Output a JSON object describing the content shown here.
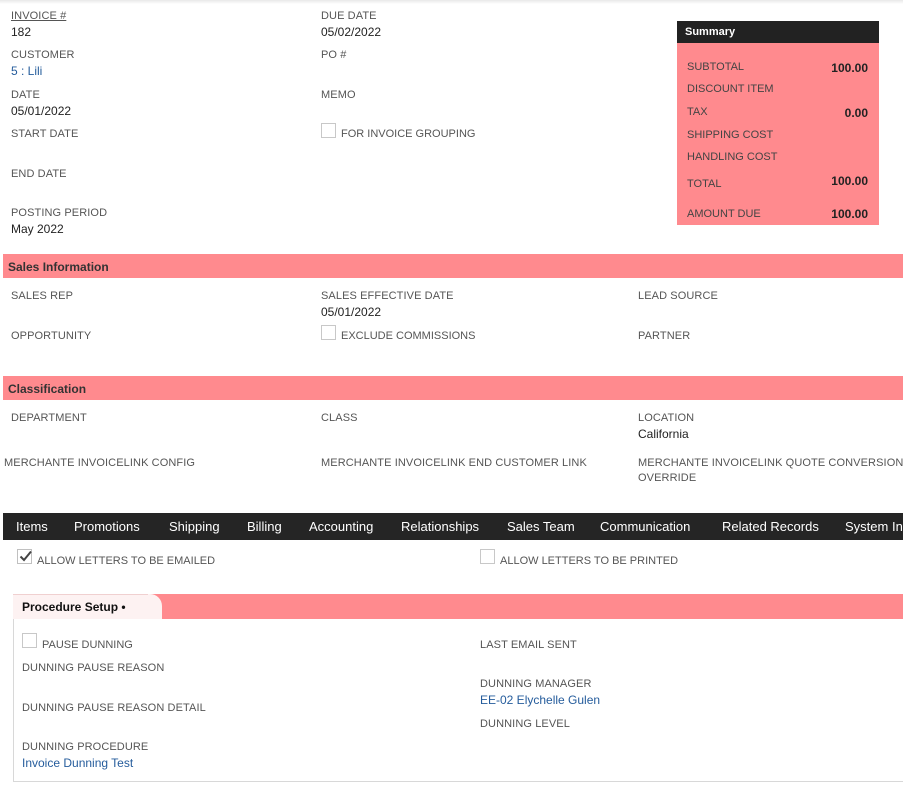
{
  "primary": {
    "invoice_label": "INVOICE #",
    "invoice_value": "182",
    "customer_label": "CUSTOMER",
    "customer_value": "5 : Lili",
    "date_label": "DATE",
    "date_value": "05/01/2022",
    "start_date_label": "START DATE",
    "end_date_label": "END DATE",
    "posting_period_label": "POSTING PERIOD",
    "posting_period_value": "May 2022",
    "due_date_label": "DUE DATE",
    "due_date_value": "05/02/2022",
    "po_label": "PO #",
    "memo_label": "MEMO",
    "invoice_grouping_label": "FOR INVOICE GROUPING"
  },
  "summary": {
    "title": "Summary",
    "subtotal_label": "SUBTOTAL",
    "subtotal_value": "100.00",
    "discount_label": "DISCOUNT ITEM",
    "tax_label": "TAX",
    "tax_value": "0.00",
    "shipping_label": "SHIPPING COST",
    "handling_label": "HANDLING COST",
    "total_label": "TOTAL",
    "total_value": "100.00",
    "amount_due_label": "AMOUNT DUE",
    "amount_due_value": "100.00"
  },
  "sales": {
    "title": "Sales Information",
    "sales_rep_label": "SALES REP",
    "opportunity_label": "OPPORTUNITY",
    "effective_date_label": "SALES EFFECTIVE DATE",
    "effective_date_value": "05/01/2022",
    "exclude_commissions_label": "EXCLUDE COMMISSIONS",
    "lead_source_label": "LEAD SOURCE",
    "partner_label": "PARTNER"
  },
  "classification": {
    "title": "Classification",
    "department_label": "DEPARTMENT",
    "class_label": "CLASS",
    "location_label": "LOCATION",
    "location_value": "California",
    "merchante_config_label": "MERCHANTE INVOICELINK CONFIG",
    "merchante_end_customer_label": "MERCHANTE INVOICELINK END CUSTOMER LINK",
    "merchante_quote_label_line1": "MERCHANTE INVOICELINK QUOTE CONVERSION LO",
    "merchante_quote_label_line2": "OVERRIDE"
  },
  "tabs": [
    {
      "label": "Items"
    },
    {
      "label": "Promotions"
    },
    {
      "label": "Shipping"
    },
    {
      "label": "Billing"
    },
    {
      "label": "Accounting"
    },
    {
      "label": "Relationships"
    },
    {
      "label": "Sales Team"
    },
    {
      "label": "Communication"
    },
    {
      "label": "Related Records"
    },
    {
      "label": "System In"
    }
  ],
  "letters": {
    "allow_emailed_label": "ALLOW LETTERS TO BE EMAILED",
    "allow_emailed_checked": true,
    "allow_printed_label": "ALLOW LETTERS TO BE PRINTED",
    "allow_printed_checked": false
  },
  "procedure": {
    "subtab_label": "Procedure Setup •",
    "pause_dunning_label": "PAUSE DUNNING",
    "pause_reason_label": "DUNNING PAUSE REASON",
    "pause_reason_detail_label": "DUNNING PAUSE REASON DETAIL",
    "procedure_label": "DUNNING PROCEDURE",
    "procedure_value": "Invoice Dunning Test",
    "last_email_label": "LAST EMAIL SENT",
    "manager_label": "DUNNING MANAGER",
    "manager_value": "EE-02 Elychelle Gulen",
    "level_label": "DUNNING LEVEL"
  },
  "colors": {
    "section_bg": "#ff8a8e",
    "tabbar_bg": "#252525",
    "link": "#255c9c"
  }
}
